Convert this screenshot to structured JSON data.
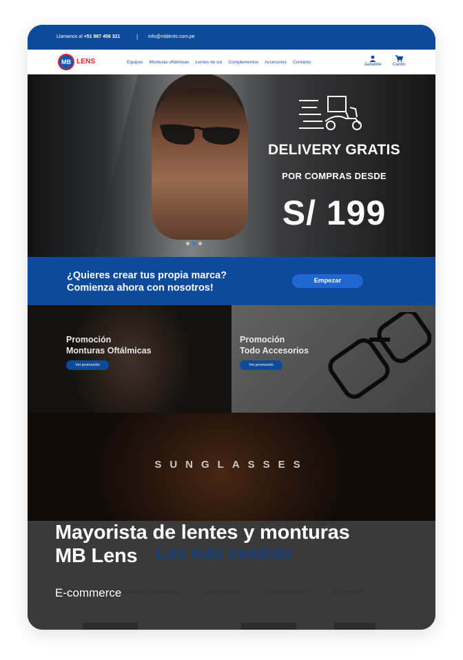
{
  "topbar": {
    "phone_prefix": "Llamanos al",
    "phone": "+51 987 456 321",
    "separator": "|",
    "email": "info@mblents.com.pe"
  },
  "nav": {
    "logo_badge": "MB",
    "logo_word": "LENS",
    "menu": [
      "Equipos",
      "Monturas oftálmicas",
      "Lentes de sol",
      "Complementos",
      "Accesorios",
      "Contacto"
    ],
    "user_label": "Jackeline",
    "cart_label": "Carrito"
  },
  "hero": {
    "line1": "DELIVERY GRATIS",
    "line2": "POR COMPRAS DESDE",
    "line3": "S/ 199",
    "slide_count": 3,
    "active_slide": 2
  },
  "band": {
    "question1": "¿Quieres crear tus propia marca?",
    "question2": "Comienza ahora con nosotros!",
    "button": "Empezar"
  },
  "promos": [
    {
      "line1": "Promoción",
      "line2": "Monturas Oftálmicas",
      "button": "Ver promoción"
    },
    {
      "line1": "Promoción",
      "line2": "Todo Accesorios",
      "button": "Ver promoción"
    }
  ],
  "sunglasses": {
    "word": "SUNGLASSES"
  },
  "bestsellers": {
    "title": "Los más vendido",
    "tabs": [
      "Equipos",
      "Monturas Oftálmicas",
      "Lentes de sol",
      "Complementos",
      "Accesorios"
    ]
  },
  "overlay": {
    "title_line1": "Mayorista de lentes y monturas",
    "title_line2": "MB Lens",
    "subtitle": "E-commerce"
  },
  "colors": {
    "primary_blue": "#0c4a9c",
    "button_blue": "#1e66d0",
    "logo_red": "#d9232b"
  }
}
